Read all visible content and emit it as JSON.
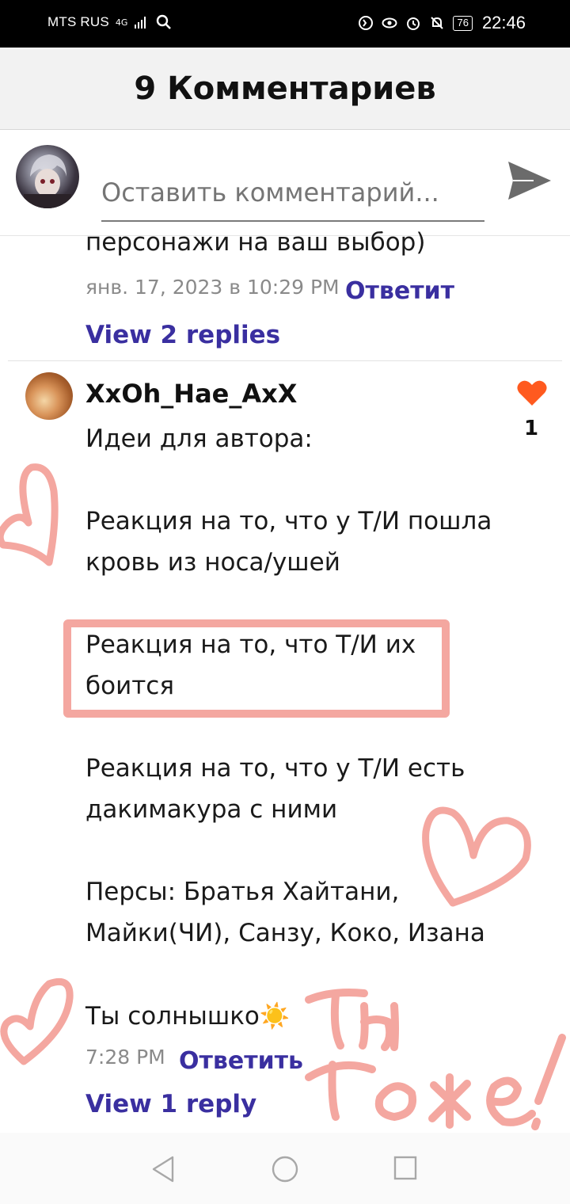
{
  "status_bar": {
    "carrier": "MTS RUS",
    "network": "4G",
    "battery": "76",
    "time": "22:46"
  },
  "header": {
    "title": "9 Комментариев"
  },
  "compose": {
    "placeholder": "Оставить комментарий..."
  },
  "comments": [
    {
      "text_fragment": "персонажи на ваш выбор)",
      "timestamp": "янв. 17, 2023 в 10:29 PM",
      "reply_label": "Ответит",
      "view_replies": "View 2 replies"
    },
    {
      "username": "XxOh_Hae_AxX",
      "likes": "1",
      "lines": [
        "Идеи для автора:",
        "Реакция на то, что у Т/И пошла",
        "кровь из носа/ушей",
        "Реакция на то, что Т/И их",
        "боится",
        "Реакция на то, что у Т/И есть",
        "дакимакура с ними",
        "Персы: Братья Хайтани,",
        "Майки(ЧИ), Санзу, Коко, Изана",
        "Ты солнышко☀️"
      ],
      "timestamp": "7:28 PM",
      "reply_label": "Ответить",
      "view_replies": "View 1 reply"
    }
  ],
  "annotations": {
    "handwritten": "Ты тоже!"
  },
  "colors": {
    "accent": "#3a2fa0",
    "like": "#ff5a1f",
    "doodle": "#f4a7a0"
  },
  "icons": {
    "send": "send-icon",
    "like": "heart-icon",
    "back": "nav-back-icon",
    "home": "nav-home-icon",
    "recents": "nav-recents-icon"
  }
}
